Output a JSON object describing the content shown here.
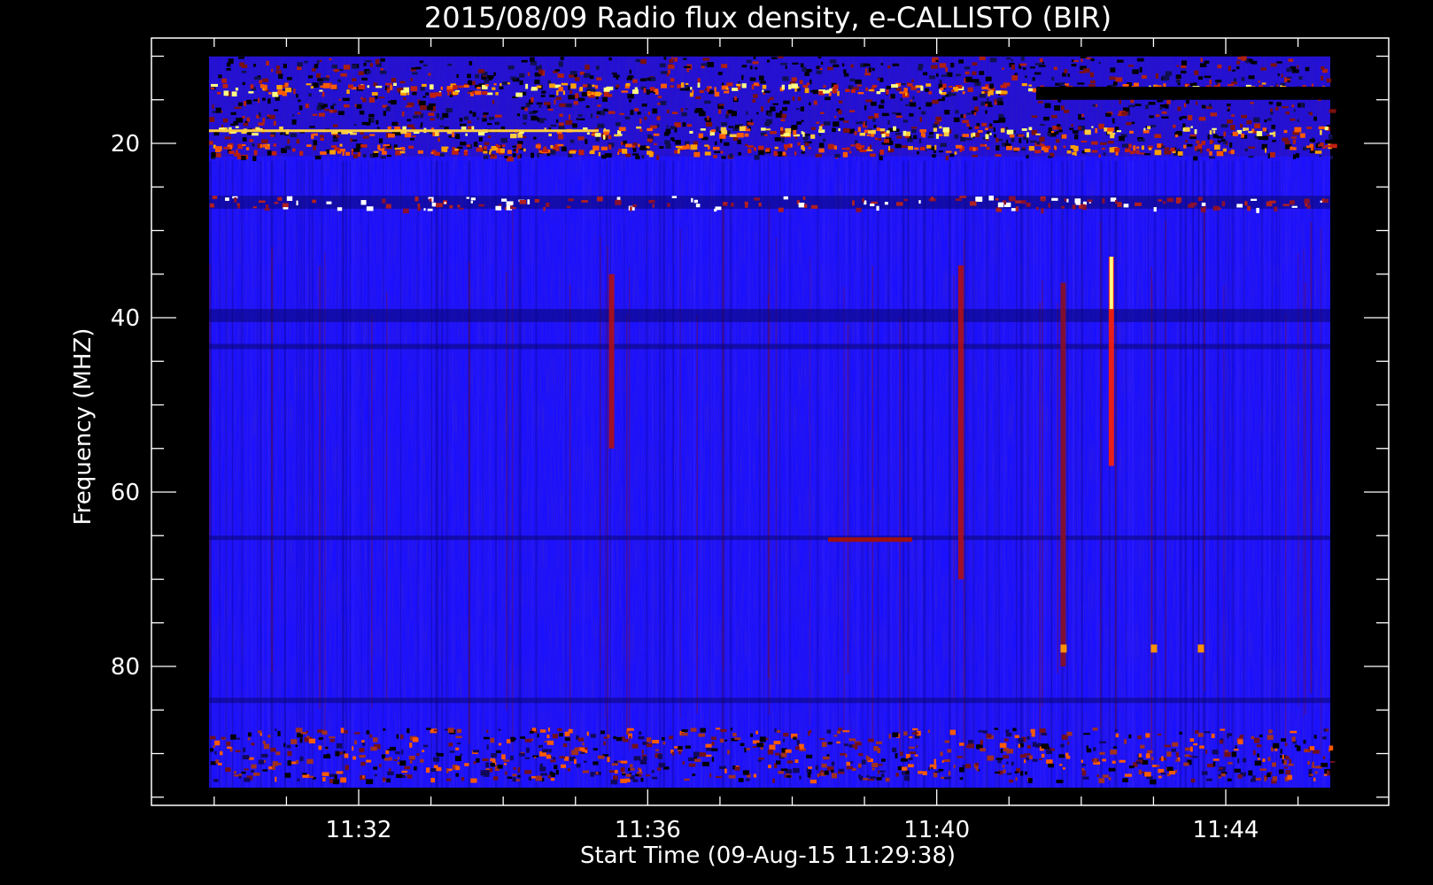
{
  "chart_data": {
    "type": "heatmap",
    "title": "2015/08/09  Radio flux density, e-CALLISTO (BIR)",
    "xlabel": "Start Time (09-Aug-15 11:29:38)",
    "ylabel": "Frequency (MHZ)",
    "x_ticks": [
      "11:32",
      "11:36",
      "11:40",
      "11:44"
    ],
    "y_ticks": [
      "20",
      "40",
      "60",
      "80"
    ],
    "x_range_minutes": [
      11.5,
      15.0
    ],
    "x_tick_minutes": [
      32,
      36,
      40,
      44
    ],
    "x_plot_range": [
      "11:29:38",
      "11:45:15"
    ],
    "y_range_mhz": [
      10,
      94
    ],
    "y_plot_axis_range": [
      5,
      97
    ],
    "y_tick_values": [
      20,
      40,
      60,
      80
    ],
    "y_inverted": true,
    "colormap": [
      "#000000",
      "#1a10ff",
      "#9b1010",
      "#ff5a00",
      "#ffff80"
    ],
    "background_color": "#1a10ff",
    "features": [
      {
        "name": "type III burst",
        "time": "11:42:25",
        "f_start_mhz": 33,
        "f_end_mhz": 57,
        "intensity": "high"
      },
      {
        "name": "type III burst",
        "time": "11:40:20",
        "f_start_mhz": 34,
        "f_end_mhz": 70,
        "intensity": "medium"
      },
      {
        "name": "type III burst",
        "time": "11:35:30",
        "f_start_mhz": 35,
        "f_end_mhz": 55,
        "intensity": "medium"
      },
      {
        "name": "type III burst",
        "time": "11:41:45",
        "f_start_mhz": 36,
        "f_end_mhz": 80,
        "intensity": "low"
      },
      {
        "name": "RFI band",
        "f_mhz": [
          12,
          21
        ],
        "intensity": "high"
      },
      {
        "name": "RFI band",
        "f_mhz": [
          87,
          93
        ],
        "intensity": "medium"
      }
    ],
    "grid": false
  }
}
